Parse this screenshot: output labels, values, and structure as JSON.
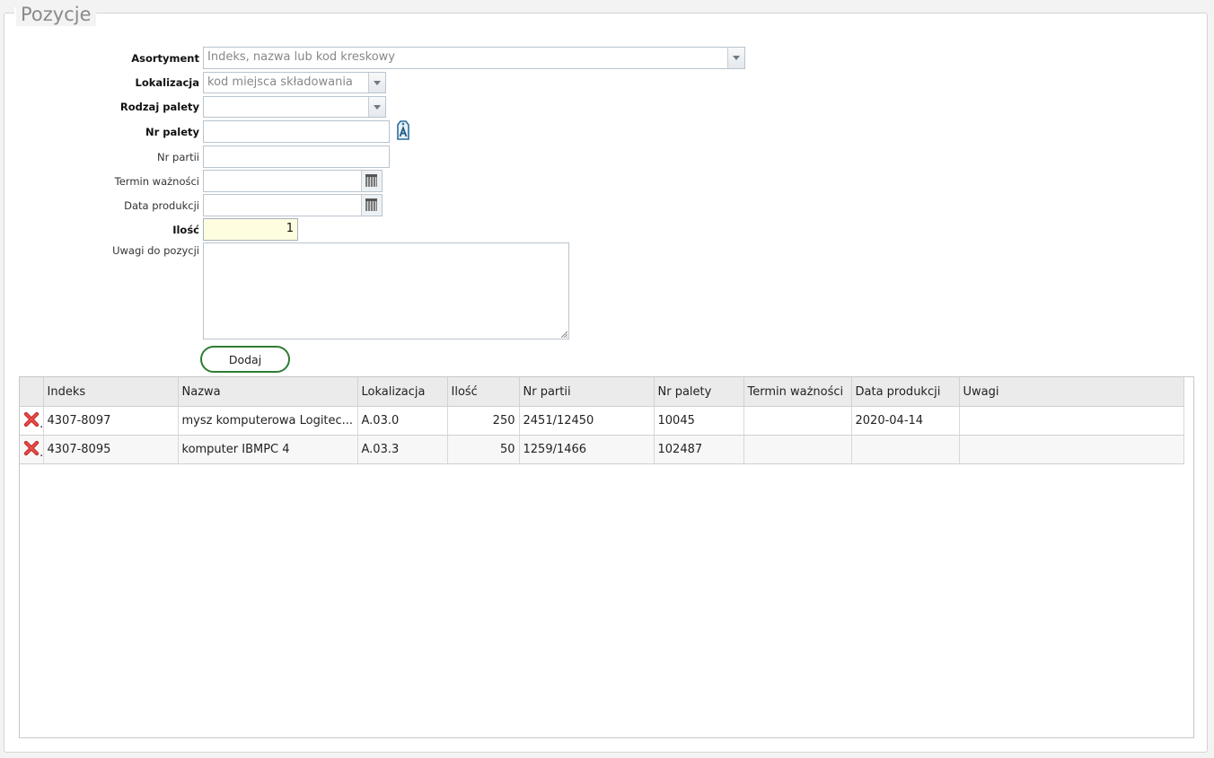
{
  "legend": "Pozycje",
  "form": {
    "assortment": {
      "label": "Asortyment",
      "placeholder": "Indeks, nazwa lub kod kreskowy",
      "value": ""
    },
    "location": {
      "label": "Lokalizacja",
      "placeholder": "kod miejsca składowania",
      "value": ""
    },
    "pallet_type": {
      "label": "Rodzaj palety",
      "value": ""
    },
    "pallet_no": {
      "label": "Nr palety",
      "value": ""
    },
    "batch_no": {
      "label": "Nr partii",
      "value": ""
    },
    "expiry_date": {
      "label": "Termin ważności",
      "value": ""
    },
    "production_date": {
      "label": "Data produkcji",
      "value": ""
    },
    "quantity": {
      "label": "Ilość",
      "value": "1"
    },
    "notes": {
      "label": "Uwagi do pozycji",
      "value": ""
    },
    "add_button": "Dodaj"
  },
  "icons": {
    "pallet_generate": "tag-a-icon",
    "delete_row": "red-x-icon",
    "calendar": "calendar-icon"
  },
  "colors": {
    "add_button_border": "#2e7d32",
    "delete_icon": "#d32f2f",
    "quantity_bg": "#fffde0"
  },
  "table": {
    "columns": [
      "",
      "Indeks",
      "Nazwa",
      "Lokalizacja",
      "Ilość",
      "Nr partii",
      "Nr palety",
      "Termin ważności",
      "Data produkcji",
      "Uwagi"
    ],
    "rows": [
      {
        "index": "4307-8097",
        "name": "mysz komputerowa Logitec...",
        "location": "A.03.0",
        "qty": "250",
        "batch": "2451/12450",
        "pallet": "10045",
        "expiry": "",
        "production": "2020-04-14",
        "notes": ""
      },
      {
        "index": "4307-8095",
        "name": "komputer IBMPC 4",
        "location": "A.03.3",
        "qty": "50",
        "batch": "1259/1466",
        "pallet": "102487",
        "expiry": "",
        "production": "",
        "notes": ""
      }
    ]
  }
}
